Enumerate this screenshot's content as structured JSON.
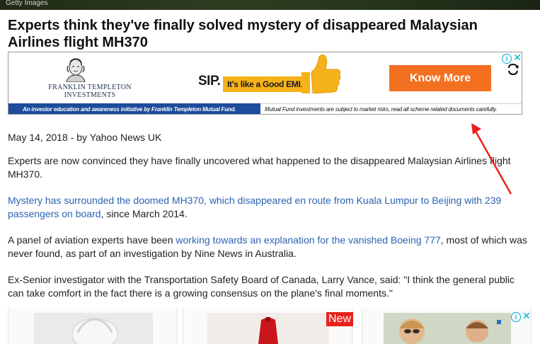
{
  "top_image": {
    "credit": "Getty Images"
  },
  "article": {
    "headline": "Experts think they've finally solved mystery of disappeared Malaysian Airlines flight MH370",
    "byline": "May 14, 2018 - by Yahoo News UK",
    "paragraphs": [
      {
        "segments": [
          {
            "text": "Experts are now convinced they have finally uncovered what happened to the disappeared Malaysian Airlines flight MH370.",
            "link": false
          }
        ]
      },
      {
        "segments": [
          {
            "text": "Mystery has surrounded the doomed MH370, which disappeared en route from Kuala Lumpur to Beijing with 239 passengers on board",
            "link": true
          },
          {
            "text": ", since March 2014.",
            "link": false
          }
        ]
      },
      {
        "segments": [
          {
            "text": "A panel of aviation experts have been ",
            "link": false
          },
          {
            "text": "working towards an explanation for the vanished Boeing 777",
            "link": true
          },
          {
            "text": ", most of which was never found, as part of an investigation by Nine News in Australia.",
            "link": false
          }
        ]
      },
      {
        "segments": [
          {
            "text": "Ex-Senior investigator with the Transportation Safety Board of Canada, Larry Vance, said: \"I think the general public can take comfort in the fact there is a growing consensus on the plane's final moments.\"",
            "link": false
          }
        ]
      }
    ]
  },
  "ad": {
    "brand_line1": "FRANKLIN TEMPLETON",
    "brand_line2": "INVESTMENTS",
    "sip_label": "SIP.",
    "emi_tagline": "It's like a Good EMI.",
    "cta_label": "Know More",
    "footer_left": "An investor education and awareness initiative by Franklin Templeton Mutual Fund.",
    "footer_right": "Mutual Fund investments are subject to market risks, read all scheme related documents carefully.",
    "choices_icon": "adchoices-icon",
    "close_glyph": "✕",
    "choices_glyph": "i",
    "colors": {
      "cta": "#f37021",
      "footer": "#1d4c9a",
      "pill": "#f6b21a"
    }
  },
  "recommendations": {
    "new_badge": "New",
    "choices_glyph": "i",
    "close_glyph": "✕",
    "cards": [
      {
        "icon": "sculpture-thumbnail"
      },
      {
        "icon": "dress-thumbnail"
      },
      {
        "icon": "girl-thumbnail"
      }
    ]
  },
  "annotation": {
    "color": "#e8211c",
    "icon": "red-arrow-annotation"
  },
  "colors": {
    "link": "#2b63b3",
    "text": "#222222"
  }
}
